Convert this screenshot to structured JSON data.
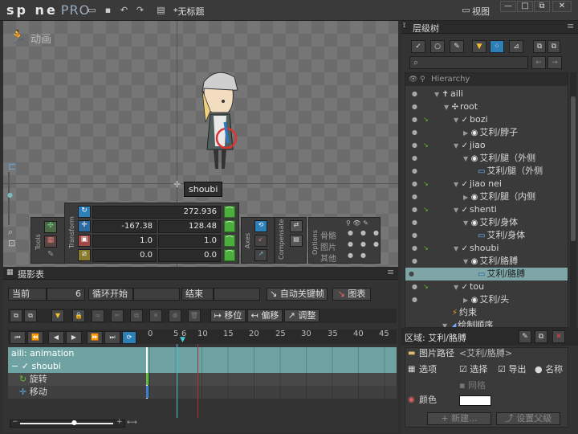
{
  "app": {
    "logo": "sp   ne",
    "logo_pro": "PRO",
    "doc_title": "*无标题",
    "view_menu": "视图"
  },
  "viewport": {
    "mode_label": "动画",
    "bone_label": "shoubi"
  },
  "transform": {
    "rotate": "272.936",
    "translate_x": "-167.38",
    "translate_y": "128.48",
    "scale_x": "1.0",
    "scale_y": "1.0",
    "shear_x": "0.0",
    "shear_y": "0.0",
    "section_tools": "Tools",
    "section_transform": "Transform",
    "section_axes": "Axes",
    "section_compensate": "Compensate",
    "section_options": "Options",
    "options": [
      "骨骼",
      "图片",
      "其他"
    ]
  },
  "dopesheet": {
    "tab": "摄影表",
    "current_label": "当前",
    "current_value": "6",
    "loop_start_label": "循环开始",
    "end_label": "结束",
    "auto_key": "自动关键帧",
    "chart": "图表",
    "move": "移位",
    "offset": "偏移",
    "adjust": "调整",
    "ruler": [
      "0",
      "5",
      "10",
      "15",
      "20",
      "25",
      "30",
      "35",
      "40",
      "45"
    ],
    "ruler_current": "6",
    "rows": [
      "aili: animation",
      "shoubi",
      "旋转",
      "移动"
    ]
  },
  "hierarchy": {
    "tab": "层级树",
    "header": "Hierarchy",
    "items": [
      {
        "label": "aili",
        "icon": "skeleton-icon"
      },
      {
        "label": "root",
        "icon": "root-icon"
      },
      {
        "label": "bozi",
        "icon": "bone-icon"
      },
      {
        "label": "艾利/脖子",
        "icon": "slot-icon"
      },
      {
        "label": "jiao",
        "icon": "bone-icon"
      },
      {
        "label": "艾利/腿（外侧",
        "icon": "slot-icon"
      },
      {
        "label": "艾利/腿（外侧",
        "icon": "attachment-icon"
      },
      {
        "label": "jiao nei",
        "icon": "bone-icon"
      },
      {
        "label": "艾利/腿（内侧",
        "icon": "slot-icon"
      },
      {
        "label": "shenti",
        "icon": "bone-icon"
      },
      {
        "label": "艾利/身体",
        "icon": "slot-icon"
      },
      {
        "label": "艾利/身体",
        "icon": "attachment-icon"
      },
      {
        "label": "shoubi",
        "icon": "bone-icon"
      },
      {
        "label": "艾利/胳膊",
        "icon": "slot-icon"
      },
      {
        "label": "艾利/胳膊",
        "icon": "attachment-icon"
      },
      {
        "label": "tou",
        "icon": "bone-icon"
      },
      {
        "label": "艾利/头",
        "icon": "slot-icon"
      },
      {
        "label": "约束",
        "icon": "constraint-icon"
      },
      {
        "label": "绘制顺序",
        "icon": "draw-order-icon"
      }
    ]
  },
  "properties": {
    "title": "区域: 艾利/胳膊",
    "image_path_label": "图片路径",
    "image_path_value": "<艾利/胳膊>",
    "options_label": "选项",
    "opt_select": "选择",
    "opt_export": "导出",
    "opt_name": "名称",
    "opt_mesh": "网格",
    "color_label": "颜色",
    "new_btn": "新建...",
    "set_parent_btn": "设置父级"
  },
  "colors": {
    "accent_green": "#4caf3d",
    "selection": "#7ea6a6",
    "timeline_row": "#6fa3a3",
    "playhead": "#d44"
  }
}
